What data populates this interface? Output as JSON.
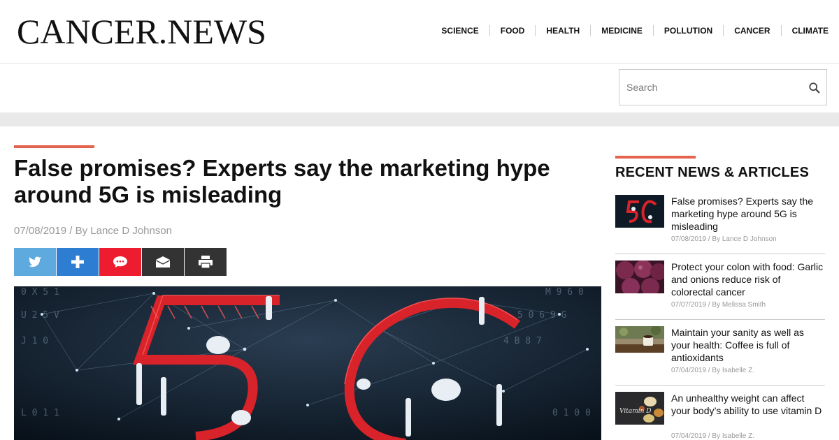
{
  "site": {
    "logo": "CANCER.NEWS"
  },
  "nav": {
    "items": [
      "SCIENCE",
      "FOOD",
      "HEALTH",
      "MEDICINE",
      "POLLUTION",
      "CANCER",
      "CLIMATE"
    ]
  },
  "search": {
    "placeholder": "Search",
    "icon": "search-icon"
  },
  "colors": {
    "accent": "#e4644f",
    "twitter": "#5ea9dd",
    "add": "#2d7dd2",
    "comment": "#ed1c2e",
    "email": "#333333",
    "print": "#333333"
  },
  "article": {
    "title": "False promises? Experts say the marketing hype around 5G is misleading",
    "date": "07/08/2019",
    "separator": "/",
    "author_prefix": "By",
    "author": "Lance D Johnson",
    "share_buttons": [
      "twitter-icon",
      "plus-icon",
      "comment-icon",
      "email-icon",
      "print-icon"
    ]
  },
  "sidebar": {
    "title": "RECENT NEWS & ARTICLES",
    "items": [
      {
        "headline": "False promises? Experts say the marketing hype around 5G is misleading",
        "date": "07/08/2019",
        "sep": "/",
        "by": "By Lance D Johnson"
      },
      {
        "headline": "Protect your colon with food: Garlic and onions reduce risk of colorectal cancer",
        "date": "07/07/2019",
        "sep": "/",
        "by": "By Melissa Smith"
      },
      {
        "headline": "Maintain your sanity as well as your health: Coffee is full of antioxidants",
        "date": "07/04/2019",
        "sep": "/",
        "by": "By Isabelle Z."
      },
      {
        "headline": "An unhealthy weight can affect your body’s ability to use vitamin D",
        "date": "07/04/2019",
        "sep": "/",
        "by": "By Isabelle Z."
      }
    ]
  }
}
